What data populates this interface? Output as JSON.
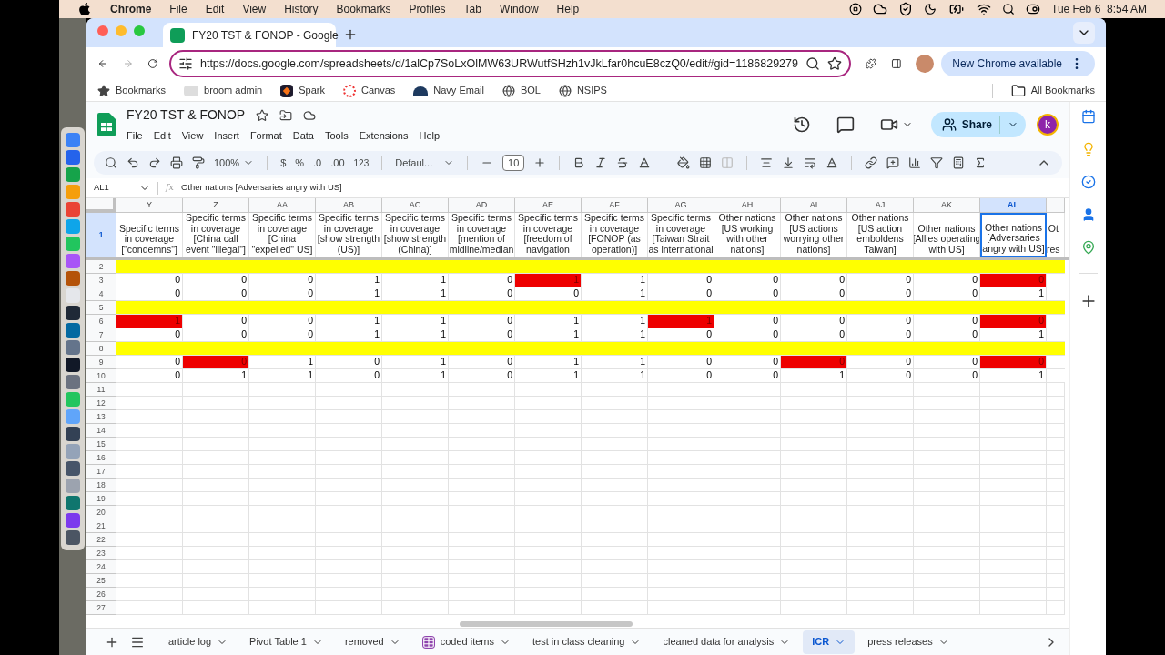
{
  "menu_bar": {
    "app": "Chrome",
    "menus": [
      "File",
      "Edit",
      "View",
      "History",
      "Bookmarks",
      "Profiles",
      "Tab",
      "Window",
      "Help"
    ],
    "clock": "Tue Feb 6  8:54 AM"
  },
  "browser": {
    "tab_title": "FY20 TST & FONOP - Google",
    "url": "https://docs.google.com/spreadsheets/d/1alCp7SoLxOlMW63URWutfSHzh1vJkLfar0hcuE8czQ0/edit#gid=1186829279",
    "update_button": "New Chrome available",
    "bookmarks": [
      {
        "label": "Bookmarks",
        "kind": "star"
      },
      {
        "label": "broom admin",
        "kind": "psa"
      },
      {
        "label": "Spark",
        "kind": "spark"
      },
      {
        "label": "Canvas",
        "kind": "canvas"
      },
      {
        "label": "Navy Email",
        "kind": "navy"
      },
      {
        "label": "BOL",
        "kind": "globe"
      },
      {
        "label": "NSIPS",
        "kind": "globe"
      }
    ],
    "all_bookmarks": "All Bookmarks"
  },
  "sheets": {
    "title": "FY20 TST & FONOP",
    "menus": [
      "File",
      "Edit",
      "View",
      "Insert",
      "Format",
      "Data",
      "Tools",
      "Extensions",
      "Help"
    ],
    "toolbar": {
      "zoom": "100%",
      "currency": "$",
      "percent": "%",
      "decrease_decimal": ".0",
      "increase_decimal": ".00",
      "number_format": "123",
      "font": "Defaul...",
      "font_size": "10"
    },
    "name_box": "AL1",
    "fx": "fx",
    "formula": "Other nations [Adversaries angry with US]",
    "share": "Share",
    "avatar": "k",
    "columns": [
      {
        "letter": "Y",
        "header": "Specific terms\nin coverage\n[\"condemns\"]",
        "selected": false
      },
      {
        "letter": "Z",
        "header": "Specific terms\nin coverage\n[China call\nevent \"illegal\"]",
        "selected": false
      },
      {
        "letter": "AA",
        "header": "Specific terms\nin coverage\n[China\n\"expelled\" US]",
        "selected": false
      },
      {
        "letter": "AB",
        "header": "Specific terms\nin coverage\n[show strength\n(US)]",
        "selected": false
      },
      {
        "letter": "AC",
        "header": "Specific terms\nin coverage\n[show strength\n(China)]",
        "selected": false
      },
      {
        "letter": "AD",
        "header": "Specific terms\nin coverage\n[mention of\nmidline/median",
        "selected": false
      },
      {
        "letter": "AE",
        "header": "Specific terms\nin coverage\n[freedom of\nnavigation",
        "selected": false
      },
      {
        "letter": "AF",
        "header": "Specific terms\nin coverage\n[FONOP (as\noperation)]",
        "selected": false
      },
      {
        "letter": "AG",
        "header": "Specific terms\nin coverage\n[Taiwan Strait\nas international",
        "selected": false
      },
      {
        "letter": "AH",
        "header": "Other nations\n[US working\nwith other\nnations]",
        "selected": false
      },
      {
        "letter": "AI",
        "header": "Other nations\n[US actions\nworrying other\nnations]",
        "selected": false
      },
      {
        "letter": "AJ",
        "header": "Other nations\n[US action\nemboldens\nTaiwan]",
        "selected": false
      },
      {
        "letter": "AK",
        "header": "Other nations\n[Allies operating\nwith US]",
        "selected": false
      },
      {
        "letter": "AL",
        "header": "Other nations\n[Adversaries\nangry with US]",
        "selected": true
      },
      {
        "header": "Ot\n\nres",
        "selected": false
      }
    ],
    "rows": [
      {
        "number": "1",
        "kind": "header",
        "selected": true
      },
      {
        "number": "2",
        "kind": "band",
        "selected": false
      },
      {
        "number": "3",
        "kind": "data",
        "selected": false,
        "cells": [
          {
            "value": "0",
            "flagged": false
          },
          {
            "value": "0",
            "flagged": false
          },
          {
            "value": "0",
            "flagged": false
          },
          {
            "value": "1",
            "flagged": false
          },
          {
            "value": "1",
            "flagged": false
          },
          {
            "value": "0",
            "flagged": false
          },
          {
            "value": "1",
            "flagged": true
          },
          {
            "value": "1",
            "flagged": false
          },
          {
            "value": "0",
            "flagged": false
          },
          {
            "value": "0",
            "flagged": false
          },
          {
            "value": "0",
            "flagged": false
          },
          {
            "value": "0",
            "flagged": false
          },
          {
            "value": "0",
            "flagged": false
          },
          {
            "value": "0",
            "flagged": true
          }
        ]
      },
      {
        "number": "4",
        "kind": "data",
        "selected": false,
        "cells": [
          {
            "value": "0",
            "flagged": false
          },
          {
            "value": "0",
            "flagged": false
          },
          {
            "value": "0",
            "flagged": false
          },
          {
            "value": "1",
            "flagged": false
          },
          {
            "value": "1",
            "flagged": false
          },
          {
            "value": "0",
            "flagged": false
          },
          {
            "value": "0",
            "flagged": false
          },
          {
            "value": "1",
            "flagged": false
          },
          {
            "value": "0",
            "flagged": false
          },
          {
            "value": "0",
            "flagged": false
          },
          {
            "value": "0",
            "flagged": false
          },
          {
            "value": "0",
            "flagged": false
          },
          {
            "value": "0",
            "flagged": false
          },
          {
            "value": "1",
            "flagged": false
          }
        ]
      },
      {
        "number": "5",
        "kind": "band",
        "selected": false
      },
      {
        "number": "6",
        "kind": "data",
        "selected": false,
        "cells": [
          {
            "value": "1",
            "flagged": true
          },
          {
            "value": "0",
            "flagged": false
          },
          {
            "value": "0",
            "flagged": false
          },
          {
            "value": "1",
            "flagged": false
          },
          {
            "value": "1",
            "flagged": false
          },
          {
            "value": "0",
            "flagged": false
          },
          {
            "value": "1",
            "flagged": false
          },
          {
            "value": "1",
            "flagged": false
          },
          {
            "value": "1",
            "flagged": true
          },
          {
            "value": "0",
            "flagged": false
          },
          {
            "value": "0",
            "flagged": false
          },
          {
            "value": "0",
            "flagged": false
          },
          {
            "value": "0",
            "flagged": false
          },
          {
            "value": "0",
            "flagged": true
          }
        ]
      },
      {
        "number": "7",
        "kind": "data",
        "selected": false,
        "cells": [
          {
            "value": "0",
            "flagged": false
          },
          {
            "value": "0",
            "flagged": false
          },
          {
            "value": "0",
            "flagged": false
          },
          {
            "value": "1",
            "flagged": false
          },
          {
            "value": "1",
            "flagged": false
          },
          {
            "value": "0",
            "flagged": false
          },
          {
            "value": "1",
            "flagged": false
          },
          {
            "value": "1",
            "flagged": false
          },
          {
            "value": "0",
            "flagged": false
          },
          {
            "value": "0",
            "flagged": false
          },
          {
            "value": "0",
            "flagged": false
          },
          {
            "value": "0",
            "flagged": false
          },
          {
            "value": "0",
            "flagged": false
          },
          {
            "value": "1",
            "flagged": false
          }
        ]
      },
      {
        "number": "8",
        "kind": "band",
        "selected": false
      },
      {
        "number": "9",
        "kind": "data",
        "selected": false,
        "cells": [
          {
            "value": "0",
            "flagged": false
          },
          {
            "value": "0",
            "flagged": true
          },
          {
            "value": "1",
            "flagged": false
          },
          {
            "value": "0",
            "flagged": false
          },
          {
            "value": "1",
            "flagged": false
          },
          {
            "value": "0",
            "flagged": false
          },
          {
            "value": "1",
            "flagged": false
          },
          {
            "value": "1",
            "flagged": false
          },
          {
            "value": "0",
            "flagged": false
          },
          {
            "value": "0",
            "flagged": false
          },
          {
            "value": "0",
            "flagged": true
          },
          {
            "value": "0",
            "flagged": false
          },
          {
            "value": "0",
            "flagged": false
          },
          {
            "value": "0",
            "flagged": true
          }
        ]
      },
      {
        "number": "10",
        "kind": "data",
        "selected": false,
        "cells": [
          {
            "value": "0",
            "flagged": false
          },
          {
            "value": "1",
            "flagged": false
          },
          {
            "value": "1",
            "flagged": false
          },
          {
            "value": "0",
            "flagged": false
          },
          {
            "value": "1",
            "flagged": false
          },
          {
            "value": "0",
            "flagged": false
          },
          {
            "value": "1",
            "flagged": false
          },
          {
            "value": "1",
            "flagged": false
          },
          {
            "value": "0",
            "flagged": false
          },
          {
            "value": "0",
            "flagged": false
          },
          {
            "value": "1",
            "flagged": false
          },
          {
            "value": "0",
            "flagged": false
          },
          {
            "value": "0",
            "flagged": false
          },
          {
            "value": "1",
            "flagged": false
          }
        ]
      },
      {
        "number": "11",
        "kind": "empty",
        "selected": false
      },
      {
        "number": "12",
        "kind": "empty",
        "selected": false
      },
      {
        "number": "13",
        "kind": "empty",
        "selected": false
      },
      {
        "number": "14",
        "kind": "empty",
        "selected": false
      },
      {
        "number": "15",
        "kind": "empty",
        "selected": false
      },
      {
        "number": "16",
        "kind": "empty",
        "selected": false
      },
      {
        "number": "17",
        "kind": "empty",
        "selected": false
      },
      {
        "number": "18",
        "kind": "empty",
        "selected": false
      },
      {
        "number": "19",
        "kind": "empty",
        "selected": false
      },
      {
        "number": "20",
        "kind": "empty",
        "selected": false
      },
      {
        "number": "21",
        "kind": "empty",
        "selected": false
      },
      {
        "number": "22",
        "kind": "empty",
        "selected": false
      },
      {
        "number": "23",
        "kind": "empty",
        "selected": false
      },
      {
        "number": "24",
        "kind": "empty",
        "selected": false
      },
      {
        "number": "25",
        "kind": "empty",
        "selected": false
      },
      {
        "number": "26",
        "kind": "empty",
        "selected": false
      },
      {
        "number": "27",
        "kind": "empty",
        "selected": false
      }
    ],
    "sheet_tabs": [
      {
        "label": "article log",
        "selected": false,
        "table_icon": false
      },
      {
        "label": "Pivot Table 1",
        "selected": false,
        "table_icon": false
      },
      {
        "label": "removed",
        "selected": false,
        "table_icon": false
      },
      {
        "label": "coded items",
        "selected": false,
        "table_icon": true
      },
      {
        "label": "test in class cleaning",
        "selected": false,
        "table_icon": false
      },
      {
        "label": "cleaned data for analysis",
        "selected": false,
        "table_icon": false
      },
      {
        "label": "ICR",
        "selected": true,
        "table_icon": false
      },
      {
        "label": "press releases",
        "selected": false,
        "table_icon": false
      }
    ]
  }
}
